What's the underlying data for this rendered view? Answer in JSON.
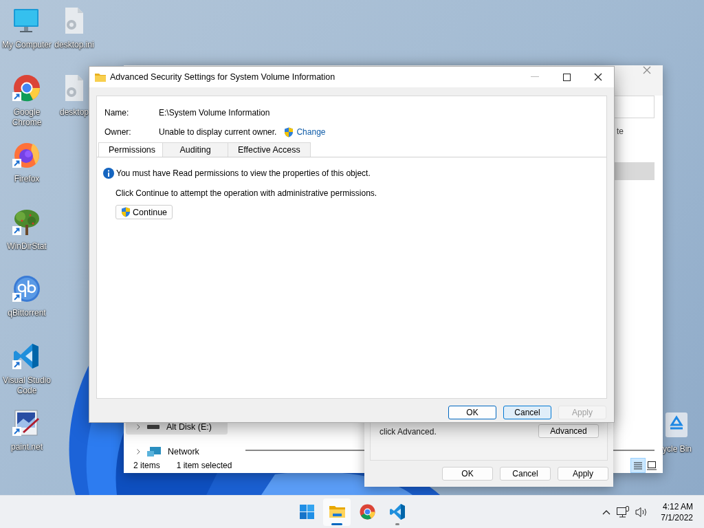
{
  "desktop": {
    "icons": [
      {
        "kind": "computer",
        "label": "My Computer",
        "shortcut": false
      },
      {
        "kind": "chrome",
        "label": "Google Chrome",
        "shortcut": true
      },
      {
        "kind": "firefox",
        "label": "Firefox",
        "shortcut": true
      },
      {
        "kind": "windirstat",
        "label": "WinDirStat",
        "shortcut": true
      },
      {
        "kind": "qbittorrent",
        "label": "qBittorrent",
        "shortcut": true
      },
      {
        "kind": "vscode",
        "label": "Visual Studio Code",
        "shortcut": true
      },
      {
        "kind": "paintnet",
        "label": "paint.net",
        "shortcut": true
      },
      {
        "kind": "settings-file",
        "label": "desktop.ini",
        "shortcut": false
      },
      {
        "kind": "settings-file",
        "label": "desktop",
        "shortcut": false
      }
    ],
    "recycle_bin": {
      "label": "ycle Bin"
    }
  },
  "explorer_window": {
    "column_text": "te",
    "nav_items": [
      {
        "label": "Alt Disk (E:)",
        "kind": "drive",
        "selected": true
      },
      {
        "label": "Network",
        "kind": "network",
        "selected": false
      }
    ],
    "status_items": "2 items",
    "status_selected": "1 item selected",
    "view_buttons": [
      {
        "kind": "details",
        "selected": true
      },
      {
        "kind": "tiles",
        "selected": false
      }
    ]
  },
  "properties_window": {
    "hint": "click Advanced.",
    "advanced_button": "Advanced",
    "buttons": [
      {
        "label": "OK",
        "disabled": false
      },
      {
        "label": "Cancel",
        "disabled": false
      },
      {
        "label": "Apply",
        "disabled": false
      }
    ]
  },
  "dialog": {
    "title": "Advanced Security Settings for System Volume Information",
    "name_label": "Name:",
    "name_value": "E:\\System Volume Information",
    "owner_label": "Owner:",
    "owner_value": "Unable to display current owner.",
    "change_link": "Change",
    "tabs": [
      {
        "label": "Permissions",
        "selected": true
      },
      {
        "label": "Auditing",
        "selected": false
      },
      {
        "label": "Effective Access",
        "selected": false
      }
    ],
    "info_message": "You must have Read permissions to view the properties of this object.",
    "instruction": "Click Continue to attempt the operation with administrative permissions.",
    "continue_button": "Continue",
    "buttons": [
      {
        "label": "OK",
        "default": true,
        "hovered": false,
        "disabled": false
      },
      {
        "label": "Cancel",
        "default": false,
        "hovered": true,
        "disabled": false
      },
      {
        "label": "Apply",
        "default": false,
        "hovered": false,
        "disabled": true
      }
    ]
  },
  "taskbar": {
    "apps": [
      {
        "kind": "start",
        "running": false,
        "selected": false
      },
      {
        "kind": "explorer",
        "running": true,
        "selected": true
      },
      {
        "kind": "chrome",
        "running": false,
        "selected": false
      },
      {
        "kind": "vscode",
        "running": true,
        "selected": false
      }
    ],
    "time": "4:12 AM",
    "date": "7/1/2022"
  }
}
